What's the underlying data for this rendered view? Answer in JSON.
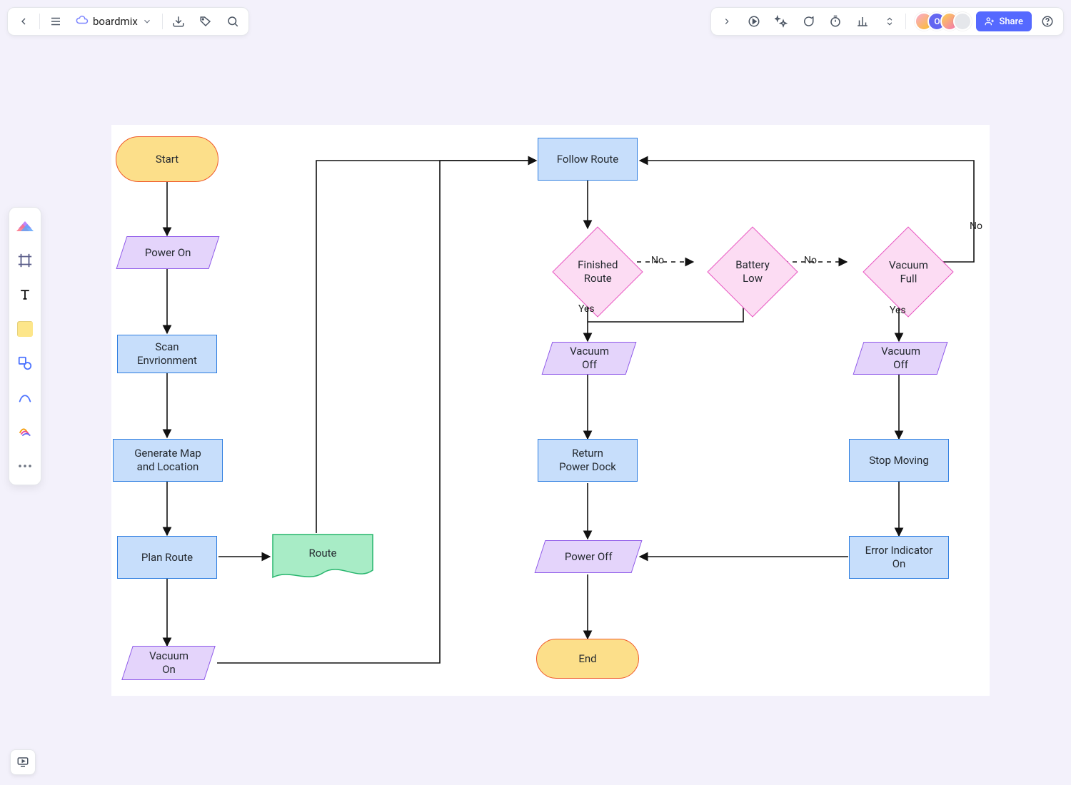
{
  "header": {
    "doc_title": "boardmix",
    "share_label": "Share",
    "avatar_letter": "O"
  },
  "nodes": {
    "start": "Start",
    "power_on": "Power On",
    "scan_env": "Scan\nEnvrionment",
    "gen_map": "Generate Map\nand Location",
    "plan_route": "Plan Route",
    "route": "Route",
    "vacuum_on": "Vacuum\nOn",
    "follow_route": "Follow Route",
    "finished_route": "Finished\nRoute",
    "battery_low": "Battery\nLow",
    "vacuum_full": "Vacuum\nFull",
    "vacuum_off_left": "Vacuum\nOff",
    "vacuum_off_right": "Vacuum\nOff",
    "return_dock": "Return\nPower Dock",
    "stop_moving": "Stop Moving",
    "error_indicator": "Error Indicator\nOn",
    "power_off": "Power Off",
    "end": "End"
  },
  "edges": {
    "yes": "Yes",
    "no": "No"
  }
}
